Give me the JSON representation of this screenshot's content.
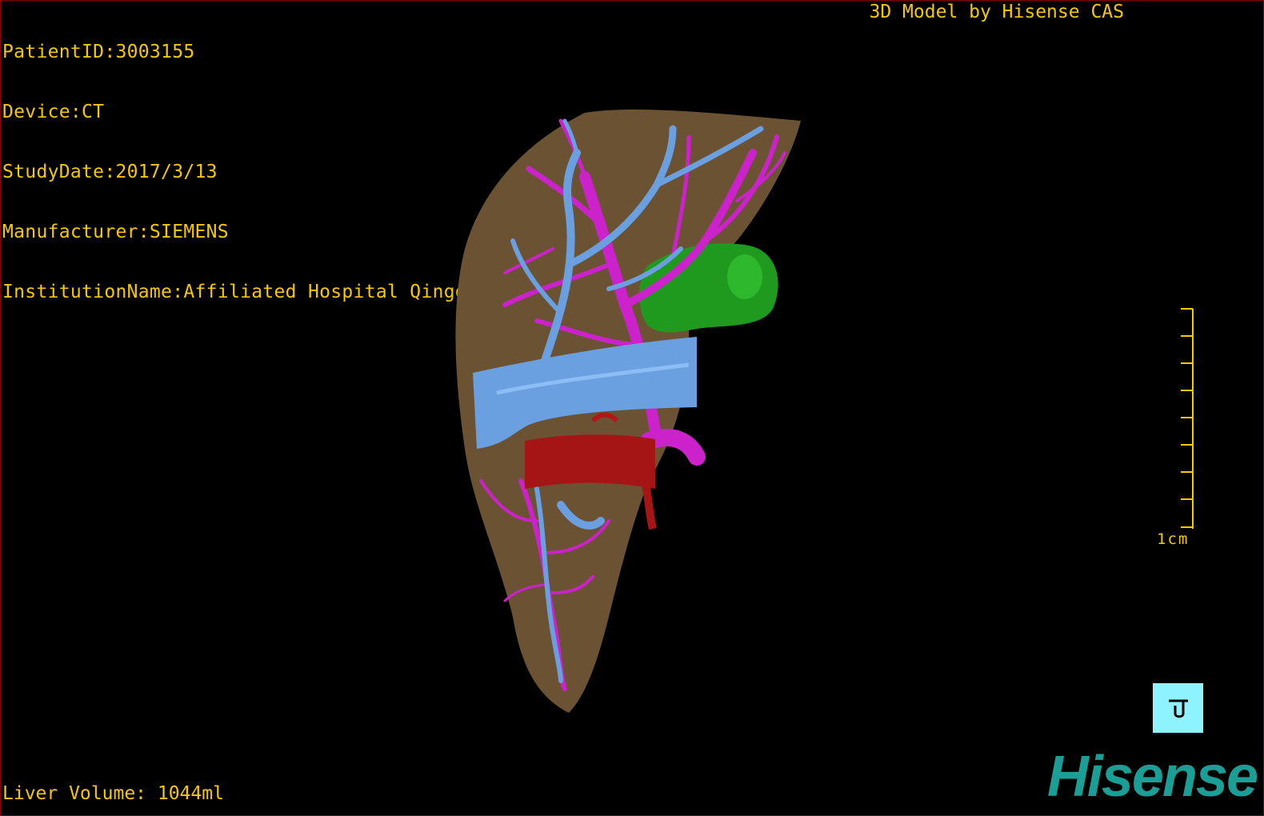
{
  "patient_info": {
    "patient_id": "PatientID:3003155",
    "device": "Device:CT",
    "study_date": "StudyDate:2017/3/13",
    "manufacturer": "Manufacturer:SIEMENS",
    "institution": "InstitutionName:Affiliated Hospital Qingdao University-C"
  },
  "brand_caption": "3D Model by Hisense CAS",
  "liver_volume": "Liver Volume: 1044ml",
  "scale": {
    "label": "1cm",
    "color": "#f5c800"
  },
  "tool_button": {
    "icon": "rotate-reset-icon",
    "color": "#8ff2ff"
  },
  "logo_text": "Hisense",
  "colors": {
    "text": "#f5c800",
    "liver": "#6b5232",
    "portal_vein": "#6a9fe0",
    "hepatic_artery": "#cc22cc",
    "vena_cava": "#a51515",
    "gallbladder": "#1f9a1f",
    "logo": "#1a9e95"
  }
}
